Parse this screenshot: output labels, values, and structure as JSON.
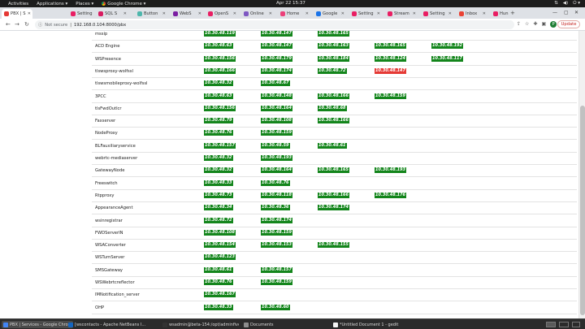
{
  "topbar": {
    "activities": "Activities",
    "applications": "Applications ▾",
    "places": "Places ▾",
    "browser": "Google Chrome ▾",
    "clock": "Apr 22  15:37"
  },
  "tabs": [
    {
      "label": "PBX | S",
      "color": "#e53935",
      "active": true
    },
    {
      "label": "Setting",
      "color": "#e91e63"
    },
    {
      "label": "SQL S",
      "color": "#d81b60"
    },
    {
      "label": "Button",
      "color": "#4db6ac"
    },
    {
      "label": "WebS",
      "color": "#7b1fa2"
    },
    {
      "label": "OpenS",
      "color": "#e91e63"
    },
    {
      "label": "Online",
      "color": "#7e57c2"
    },
    {
      "label": "Home",
      "color": "#ec407a"
    },
    {
      "label": "Google",
      "color": "#1a73e8"
    },
    {
      "label": "Setting",
      "color": "#e91e63"
    },
    {
      "label": "Stream",
      "color": "#e91e63"
    },
    {
      "label": "Setting",
      "color": "#e91e63"
    },
    {
      "label": "Inbox",
      "color": "#ea4335"
    },
    {
      "label": "Hun",
      "color": "#e91e63"
    }
  ],
  "addressbar": {
    "secure_label": "Not secure",
    "url": "192.168.0.104:8000/pbx",
    "update_label": "Update",
    "profile_initial": "P"
  },
  "services": [
    {
      "name": "mssip",
      "ips": [
        "10.30.48.119",
        "10.30.48.147",
        "10.30.48.165",
        "",
        ""
      ]
    },
    {
      "name": "ACD Engine",
      "ips": [
        "10.30.48.63",
        "10.30.48.147",
        "10.30.48.163",
        "10.30.48.165",
        "10.30.48.192"
      ]
    },
    {
      "name": "WSPresence",
      "ips": [
        "10.30.48.156",
        "10.30.48.179",
        "10.30.48.184",
        "10.30.48.124",
        "10.30.48.117"
      ]
    },
    {
      "name": "tlswsproxy-wolfssl",
      "ips": [
        "10.30.48.166",
        "10.30.48.174",
        "10.30.48.72",
        "10.30.48.147",
        ""
      ],
      "down": [
        3
      ]
    },
    {
      "name": "tlswsmobileproxy-wolfssl",
      "ips": [
        "10.30.48.32",
        "10.30.48.67",
        "",
        "",
        ""
      ]
    },
    {
      "name": "3PCC",
      "ips": [
        "10.30.48.63",
        "10.30.48.148",
        "10.30.48.166",
        "10.30.48.159",
        ""
      ]
    },
    {
      "name": "tlsFwdOutlcr",
      "ips": [
        "10.30.48.156",
        "10.30.48.164",
        "10.30.48.68",
        "",
        ""
      ]
    },
    {
      "name": "Faxserver",
      "ips": [
        "10.30.48.79",
        "10.30.48.108",
        "10.30.48.166",
        "",
        ""
      ]
    },
    {
      "name": "NodeProxy",
      "ips": [
        "10.30.48.76",
        "10.30.48.159",
        "",
        "",
        ""
      ]
    },
    {
      "name": "BLFauxiliaryservice",
      "ips": [
        "10.30.48.157",
        "10.30.48.59",
        "10.30.48.61",
        "",
        ""
      ]
    },
    {
      "name": "webrtc-mediaserver",
      "ips": [
        "10.30.48.32",
        "10.30.48.193",
        "",
        "",
        ""
      ]
    },
    {
      "name": "GatewayNode",
      "ips": [
        "10.30.48.32",
        "10.30.48.164",
        "10.30.48.165",
        "10.30.48.193",
        ""
      ]
    },
    {
      "name": "Freeswitch",
      "ips": [
        "10.30.48.33",
        "10.30.48.76",
        "",
        "",
        ""
      ]
    },
    {
      "name": "Rtpproxy",
      "ips": [
        "10.30.48.73",
        "10.30.48.118",
        "10.30.48.166",
        "10.30.48.176",
        ""
      ]
    },
    {
      "name": "AppearanceAgent",
      "ips": [
        "10.30.48.34",
        "10.30.48.36",
        "10.30.48.174",
        "",
        ""
      ]
    },
    {
      "name": "wsinregistrar",
      "ips": [
        "10.30.48.72",
        "10.30.48.174",
        "",
        "",
        ""
      ]
    },
    {
      "name": "FWDServerIN",
      "ips": [
        "10.30.48.108",
        "10.30.48.159",
        "",
        "",
        ""
      ]
    },
    {
      "name": "WSAConverter",
      "ips": [
        "10.30.48.154",
        "10.30.48.153",
        "10.30.48.155",
        "",
        ""
      ]
    },
    {
      "name": "WSTurnServer",
      "ips": [
        "10.30.48.123",
        "",
        "",
        "",
        ""
      ]
    },
    {
      "name": "SMSGateway",
      "ips": [
        "10.30.48.61",
        "10.30.48.157",
        "",
        "",
        ""
      ]
    },
    {
      "name": "WSWebrtcreflector",
      "ips": [
        "10.30.48.76",
        "10.30.48.159",
        "",
        "",
        ""
      ]
    },
    {
      "name": "IMNotification_server",
      "ips": [
        "10.30.48.167",
        "",
        "",
        "",
        ""
      ]
    },
    {
      "name": "OHP",
      "ips": [
        "10.30.48.33",
        "10.30.48.60",
        "",
        "",
        ""
      ]
    }
  ],
  "colors": {
    "up": "#13851b",
    "down": "#e53935"
  },
  "taskbar": [
    {
      "label": "PBX | Services - Google Chrome",
      "color": "#4285f4",
      "active": true
    },
    {
      "label": "[wscontacts - Apache NetBeans I...",
      "color": "#1565c0"
    },
    {
      "label": "wsadmin@beta-154:/opt/adminfive",
      "color": "#333333"
    },
    {
      "label": "Documents",
      "color": "#8d8d8d"
    },
    {
      "label": "*Untitled Document 1 - gedit",
      "color": "#f5f5f5"
    }
  ]
}
